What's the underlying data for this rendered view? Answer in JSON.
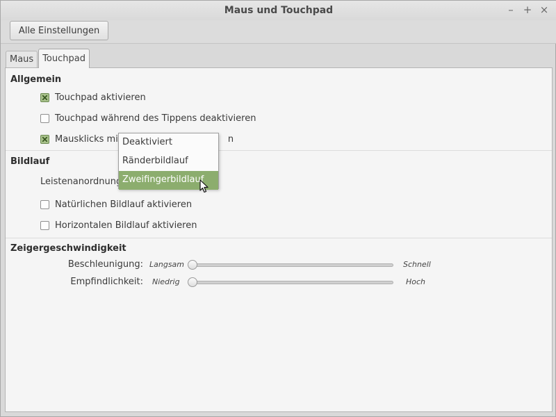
{
  "window": {
    "title": "Maus und Touchpad",
    "buttons": {
      "minimize": "–",
      "maximize": "+",
      "close": "×"
    }
  },
  "toolbar": {
    "all_settings_label": "Alle Einstellungen"
  },
  "tabs": [
    {
      "label": "Maus",
      "active": false
    },
    {
      "label": "Touchpad",
      "active": true
    }
  ],
  "sections": {
    "general": {
      "title": "Allgemein",
      "options": [
        {
          "label": "Touchpad aktivieren",
          "checked": true
        },
        {
          "label": "Touchpad während des Tippens deaktivieren",
          "checked": false
        },
        {
          "label_prefix": "Mausklicks mit",
          "label_suffix": "n",
          "checked": true
        }
      ]
    },
    "scrolling": {
      "title": "Bildlauf",
      "layout_label": "Leistenanordnung",
      "options": [
        {
          "label": "Natürlichen Bildlauf aktivieren",
          "checked": false
        },
        {
          "label": "Horizontalen Bildlauf aktivieren",
          "checked": false
        }
      ]
    },
    "pointer": {
      "title": "Zeigergeschwindigkeit",
      "acceleration": {
        "label": "Beschleunigung:",
        "min": "Langsam",
        "max": "Schnell",
        "value": 0
      },
      "sensitivity": {
        "label": "Empfindlichkeit:",
        "min": "Niedrig",
        "max": "Hoch",
        "value": 0
      }
    }
  },
  "dropdown": {
    "items": [
      {
        "label": "Deaktiviert",
        "selected": false
      },
      {
        "label": "Ränderbildlauf",
        "selected": false
      },
      {
        "label": "Zweifingerbildlauf",
        "selected": true
      }
    ]
  },
  "colors": {
    "accent": "#8cad6e",
    "background": "#f5f5f5",
    "chrome": "#d9d9d9"
  },
  "icons": {
    "cursor": "arrow-pointer-icon"
  }
}
